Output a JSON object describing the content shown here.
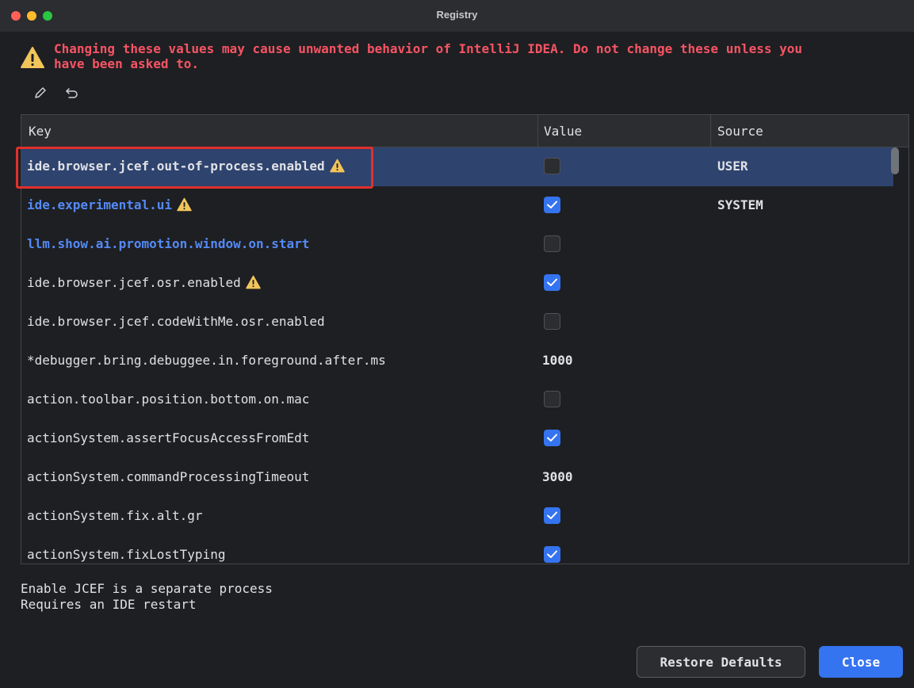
{
  "window": {
    "title": "Registry"
  },
  "warning": {
    "text": "Changing these values may cause unwanted behavior of IntelliJ IDEA. Do not change these unless you\nhave been asked to."
  },
  "toolbar": {
    "edit_icon": "pencil-icon",
    "revert_icon": "undo-icon"
  },
  "table": {
    "headers": {
      "key": "Key",
      "value": "Value",
      "source": "Source"
    },
    "rows": [
      {
        "key": "ide.browser.jcef.out-of-process.enabled",
        "warning": true,
        "style": "bold",
        "value_type": "checkbox",
        "checked": false,
        "source": "USER",
        "selected": true
      },
      {
        "key": "ide.experimental.ui",
        "warning": true,
        "style": "blue",
        "value_type": "checkbox",
        "checked": true,
        "source": "SYSTEM"
      },
      {
        "key": "llm.show.ai.promotion.window.on.start",
        "warning": false,
        "style": "blue",
        "value_type": "checkbox",
        "checked": false,
        "source": ""
      },
      {
        "key": "ide.browser.jcef.osr.enabled",
        "warning": true,
        "style": "normal",
        "value_type": "checkbox",
        "checked": true,
        "source": ""
      },
      {
        "key": "ide.browser.jcef.codeWithMe.osr.enabled",
        "warning": false,
        "style": "normal",
        "value_type": "checkbox",
        "checked": false,
        "source": ""
      },
      {
        "key": "*debugger.bring.debuggee.in.foreground.after.ms",
        "warning": false,
        "style": "normal",
        "value_type": "text",
        "value": "1000",
        "source": ""
      },
      {
        "key": "action.toolbar.position.bottom.on.mac",
        "warning": false,
        "style": "normal",
        "value_type": "checkbox",
        "checked": false,
        "source": ""
      },
      {
        "key": "actionSystem.assertFocusAccessFromEdt",
        "warning": false,
        "style": "normal",
        "value_type": "checkbox",
        "checked": true,
        "source": ""
      },
      {
        "key": "actionSystem.commandProcessingTimeout",
        "warning": false,
        "style": "normal",
        "value_type": "text",
        "value": "3000",
        "source": ""
      },
      {
        "key": "actionSystem.fix.alt.gr",
        "warning": false,
        "style": "normal",
        "value_type": "checkbox",
        "checked": true,
        "source": ""
      },
      {
        "key": "actionSystem.fixLostTyping",
        "warning": false,
        "style": "normal",
        "value_type": "checkbox",
        "checked": true,
        "source": ""
      }
    ]
  },
  "description": {
    "text": "Enable JCEF is a separate process\nRequires an IDE restart"
  },
  "buttons": {
    "restore_defaults": "Restore Defaults",
    "close": "Close"
  },
  "colors": {
    "accent": "#3574f0",
    "warning_text": "#f75464",
    "selection": "#2e436e",
    "highlight_box": "#e0312c",
    "key_blue": "#548af7"
  }
}
